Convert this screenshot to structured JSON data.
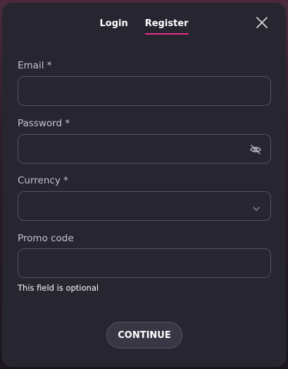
{
  "tabs": {
    "login": "Login",
    "register": "Register",
    "active": "Register"
  },
  "form": {
    "email": {
      "label": "Email *",
      "value": "",
      "placeholder": ""
    },
    "password": {
      "label": "Password *",
      "value": "",
      "placeholder": ""
    },
    "currency": {
      "label": "Currency *",
      "value": ""
    },
    "promo": {
      "label": "Promo code",
      "value": "",
      "placeholder": "",
      "hint": "This field is optional"
    }
  },
  "continue_label": "CONTINUE",
  "icons": {
    "close": "close-icon",
    "eye": "eye-off-icon",
    "dropdown": "chevron-down-icon"
  },
  "colors": {
    "accent": "#e8308a",
    "modal_bg": "#272530",
    "border": "#55525e"
  }
}
